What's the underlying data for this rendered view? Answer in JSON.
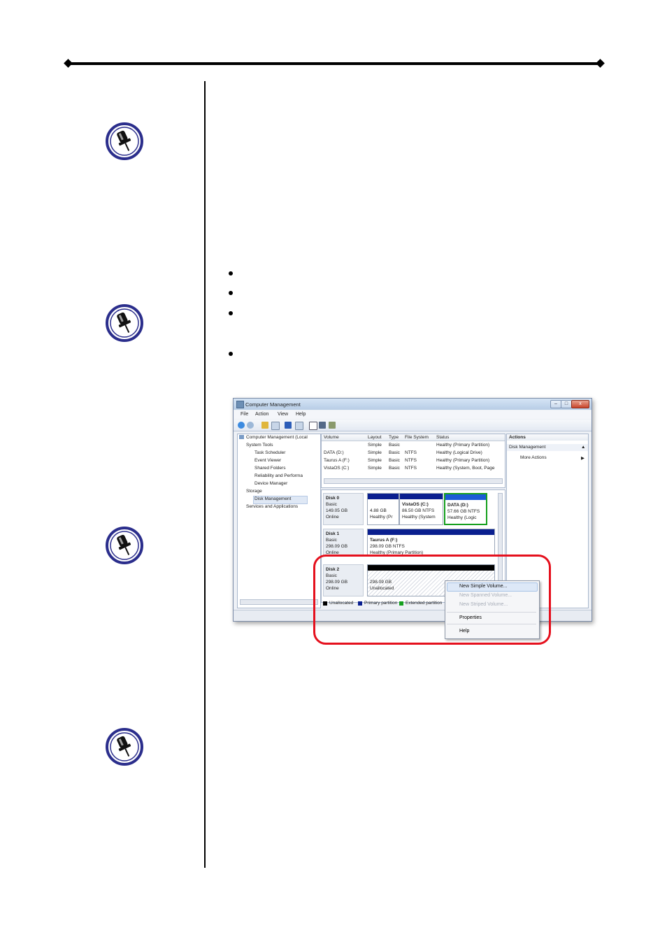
{
  "window": {
    "title": "Computer Management",
    "controls": {
      "minimize": "–",
      "maximize": "□",
      "close": "x"
    }
  },
  "menu": {
    "file": "File",
    "action": "Action",
    "view": "View",
    "help": "Help"
  },
  "tree": {
    "root": "Computer Management (Local",
    "system_tools": "System Tools",
    "task_scheduler": "Task Scheduler",
    "event_viewer": "Event Viewer",
    "shared_folders": "Shared Folders",
    "reliability": "Reliability and Performa",
    "device_manager": "Device Manager",
    "storage": "Storage",
    "disk_management": "Disk Management",
    "services": "Services and Applications"
  },
  "volume_table": {
    "headers": [
      "Volume",
      "Layout",
      "Type",
      "File System",
      "Status"
    ],
    "rows": [
      [
        "",
        "Simple",
        "Basic",
        "",
        "Healthy (Primary Partition)"
      ],
      [
        "DATA (D:)",
        "Simple",
        "Basic",
        "NTFS",
        "Healthy (Logical Drive)"
      ],
      [
        "Taurus A (F:)",
        "Simple",
        "Basic",
        "NTFS",
        "Healthy (Primary Partition)"
      ],
      [
        "VistaOS (C:)",
        "Simple",
        "Basic",
        "NTFS",
        "Healthy (System, Boot, Page"
      ]
    ]
  },
  "disks": [
    {
      "name": "Disk 0",
      "type": "Basic",
      "size": "149.05 GB",
      "status": "Online",
      "partitions": [
        {
          "name": "",
          "size": "4.88 GB",
          "status": "Healthy (Pr"
        },
        {
          "name": "VistaOS  (C:)",
          "size": "86.50 GB NTFS",
          "status": "Healthy (System"
        },
        {
          "name": "DATA  (D:)",
          "size": "57.66 GB NTFS",
          "status": "Healthy (Logic"
        }
      ]
    },
    {
      "name": "Disk 1",
      "type": "Basic",
      "size": "298.09 GB",
      "status": "Online",
      "partitions": [
        {
          "name": "Taurus A  (F:)",
          "size": "298.09 GB NTFS",
          "status": "Healthy (Primary Partition)"
        }
      ]
    },
    {
      "name": "Disk 2",
      "type": "Basic",
      "size": "298.09 GB",
      "status": "Online",
      "partitions": [
        {
          "name": "",
          "size": "298.09 GB",
          "status": "Unallocated"
        }
      ]
    }
  ],
  "legend": {
    "unallocated": "Unallocated",
    "primary": "Primary partition",
    "extended": "Extended partition"
  },
  "actions_panel": {
    "header": "Actions",
    "section": "Disk Management",
    "more": "More Actions"
  },
  "context_menu": {
    "new_simple": "New Simple Volume...",
    "new_spanned": "New Spanned Volume...",
    "new_striped": "New Striped Volume...",
    "properties": "Properties",
    "help": "Help"
  },
  "colors": {
    "primary_partition": "#0a1f8f",
    "logical_drive": "#1b5bd6",
    "extended_partition": "#16a01e",
    "unallocated": "#000000",
    "highlight_box": "#e5101d",
    "pin_icon": "#2b2e8c"
  }
}
